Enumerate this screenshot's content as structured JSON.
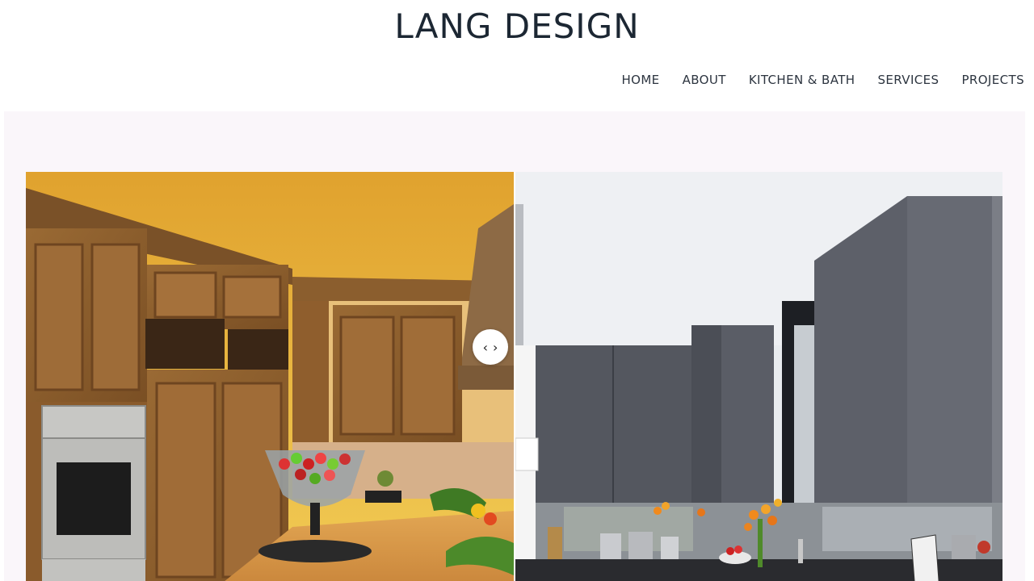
{
  "site": {
    "logo": "LANG DESIGN"
  },
  "nav": {
    "items": [
      {
        "label": "HOME"
      },
      {
        "label": "ABOUT"
      },
      {
        "label": "KITCHEN & BATH"
      },
      {
        "label": "SERVICES"
      },
      {
        "label": "PROJECTS"
      }
    ]
  },
  "comparison": {
    "slider_position": 0.5,
    "handle": {
      "left_glyph": "‹",
      "right_glyph": "›",
      "icon": "compare-arrows-icon"
    },
    "left_image": {
      "icon": "traditional-wood-kitchen-photo"
    },
    "right_image": {
      "icon": "modern-dark-kitchen-photo"
    }
  },
  "colors": {
    "logo": "#1c2733",
    "nav_text": "#2d3540",
    "hero_background": "#faf6fa"
  }
}
